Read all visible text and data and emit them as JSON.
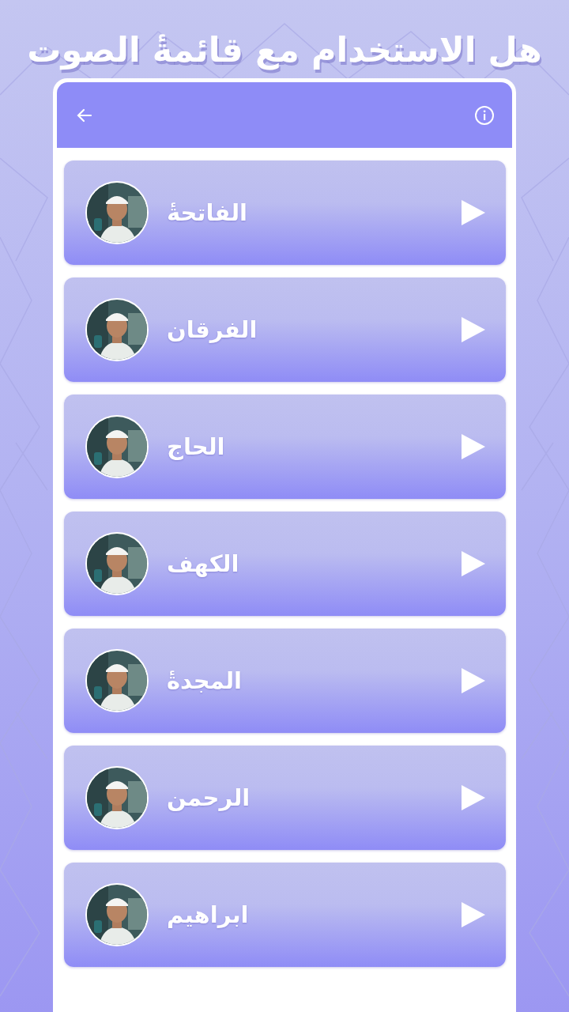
{
  "headline": "هل الاستخدام مع قائمةٔ الصوت",
  "tracks": [
    {
      "name": "الفاتحةٔ"
    },
    {
      "name": "الفرقان"
    },
    {
      "name": "الحاج"
    },
    {
      "name": "الكهف"
    },
    {
      "name": "المجدةٔ"
    },
    {
      "name": "الرحمن"
    },
    {
      "name": "ابراهيم"
    }
  ]
}
